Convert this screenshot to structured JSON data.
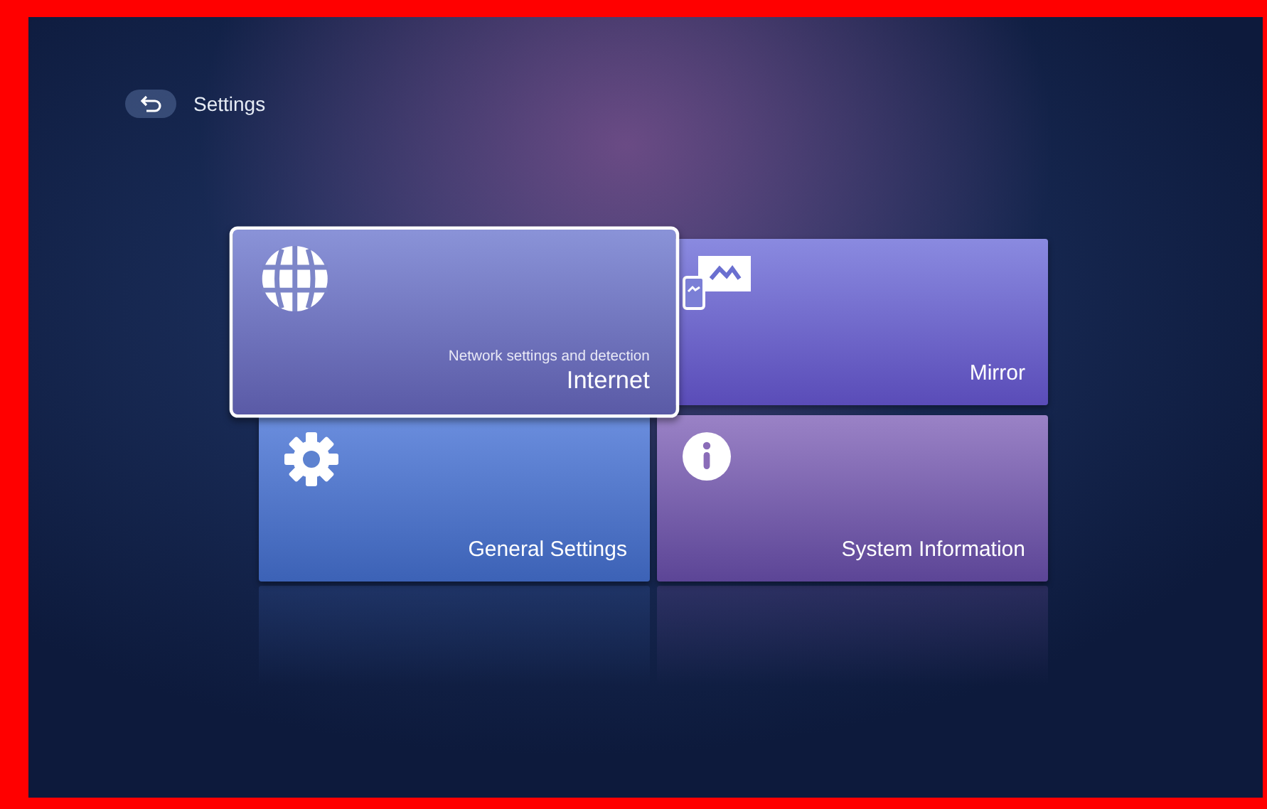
{
  "header": {
    "back_label": "Settings"
  },
  "tiles": [
    {
      "kind": "globe",
      "title": "Internet",
      "subtitle": "Network settings and detection",
      "selected": true
    },
    {
      "kind": "mirror",
      "title": "Mirror",
      "selected": false
    },
    {
      "kind": "gear",
      "title": "General Settings",
      "selected": false
    },
    {
      "kind": "info",
      "title": "System Information",
      "selected": false
    }
  ]
}
